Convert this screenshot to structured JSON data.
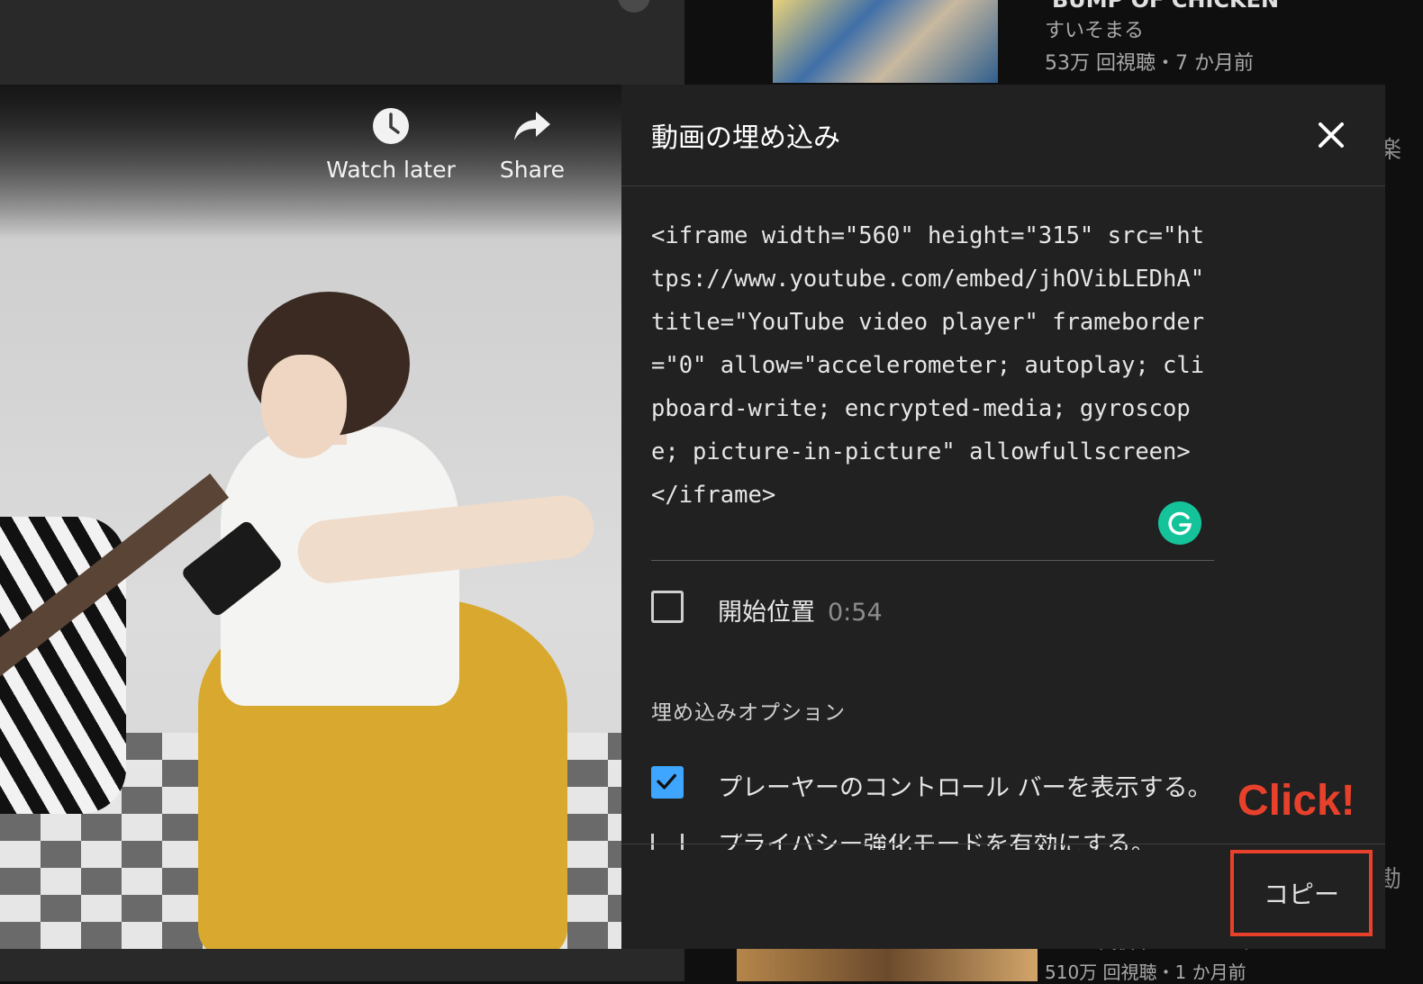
{
  "background": {
    "recommendation_top": {
      "title": "BUMP OF CHICKEN",
      "channel": "すいそまる",
      "meta": "53万 回視聴・7 か月前"
    },
    "recommendation_bottom": {
      "channel": "ツンと実夜中でいいのに。",
      "meta": "510万 回視聴・1 か月前"
    },
    "edge_chars": [
      "楽",
      "勘"
    ]
  },
  "video_overlay": {
    "watch_later_label": "Watch later",
    "share_label": "Share"
  },
  "dialog": {
    "title": "動画の埋め込み",
    "embed_code": "<iframe width=\"560\" height=\"315\" src=\"https://www.youtube.com/embed/jhOVibLEDhA\" title=\"YouTube video player\" frameborder=\"0\" allow=\"accelerometer; autoplay; clipboard-write; encrypted-media; gyroscope; picture-in-picture\" allowfullscreen></iframe>",
    "start_at": {
      "label": "開始位置",
      "time": "0:54",
      "checked": false
    },
    "options_heading": "埋め込みオプション",
    "options": [
      {
        "label": "プレーヤーのコントロール バーを表示する。",
        "checked": true
      },
      {
        "label": "プライバシー強化モードを有効にする。",
        "checked": false
      }
    ],
    "copy_button_label": "コピー"
  },
  "annotation": {
    "click_label": "Click!",
    "highlight_color": "#e8412b"
  },
  "colors": {
    "dialog_bg": "#212121",
    "checkbox_on": "#3ea6ff",
    "grammarly": "#15c39a"
  },
  "icons": [
    "clock-icon",
    "share-arrow-icon",
    "close-icon",
    "check-icon",
    "grammarly-icon"
  ]
}
